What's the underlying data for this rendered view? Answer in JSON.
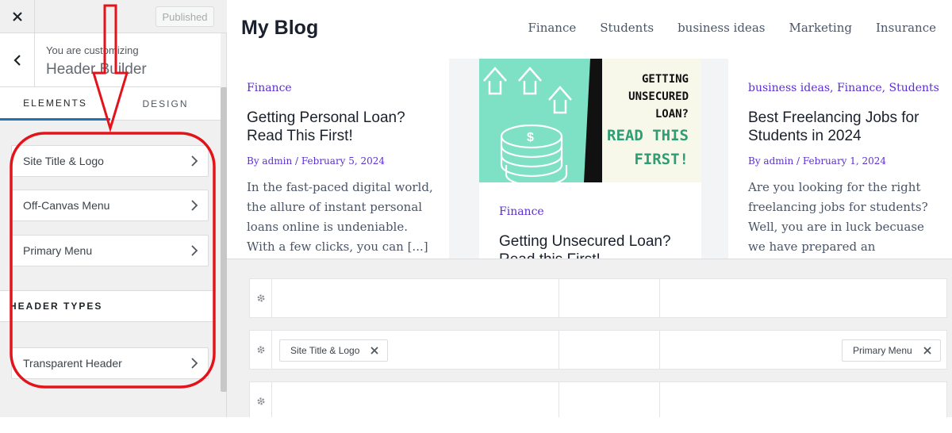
{
  "sidebar": {
    "publish_label": "Published",
    "customizing_label": "You are customizing",
    "section_title": "Header Builder",
    "tabs": [
      {
        "label": "ELEMENTS"
      },
      {
        "label": "DESIGN"
      }
    ],
    "items": [
      {
        "label": "Site Title & Logo"
      },
      {
        "label": "Off-Canvas Menu"
      },
      {
        "label": "Primary Menu"
      }
    ],
    "group_title": "HEADER TYPES",
    "group_items": [
      {
        "label": "Transparent Header"
      }
    ]
  },
  "preview": {
    "site_title": "My Blog",
    "nav": [
      "Finance",
      "Students",
      "business ideas",
      "Marketing",
      "Insurance"
    ],
    "posts": [
      {
        "categories": [
          "Finance"
        ],
        "title": "Getting Personal Loan? Read This First!",
        "meta": "By admin / February 5, 2024",
        "excerpt": "In the fast-paced digital world, the allure of instant personal loans online is undeniable. With a few clicks, you can [...]"
      },
      {
        "image_text": [
          "GETTING",
          "UNSECURED",
          "LOAN?",
          "READ THIS",
          "FIRST!"
        ],
        "categories": [
          "Finance"
        ],
        "title": "Getting Unsecured Loan? Read this First!"
      },
      {
        "categories": [
          "business ideas",
          "Finance",
          "Students"
        ],
        "title": "Best Freelancing Jobs for Students in 2024",
        "meta": "By admin / February 1, 2024",
        "excerpt": "Are you looking for the right freelancing jobs for students? Well, you are in luck becuase we have prepared an"
      }
    ]
  },
  "builder": {
    "middle_row": {
      "left_chip": "Site Title & Logo",
      "right_chip": "Primary Menu"
    }
  },
  "colors": {
    "accent": "#2271b1",
    "annotation": "#e4131b",
    "link": "#5b2fd0",
    "thumb_bg": "#7ee0c4",
    "thumb_text": "#2e9e74"
  }
}
